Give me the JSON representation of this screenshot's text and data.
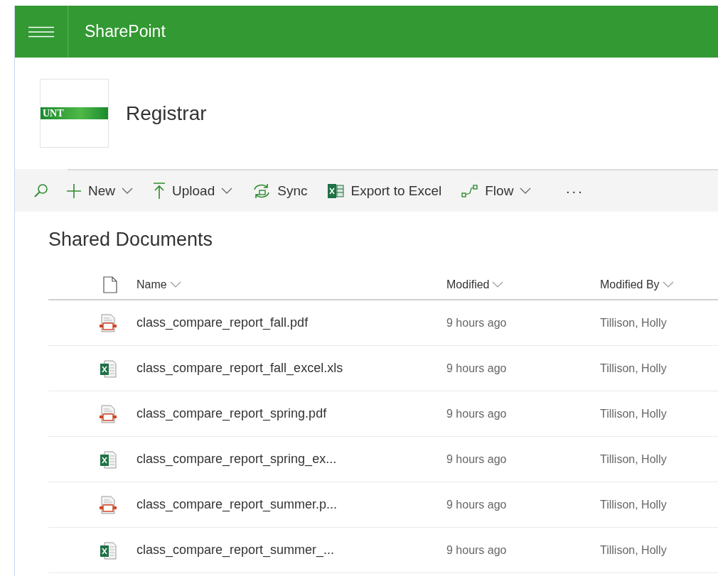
{
  "app_bar": {
    "title": "SharePoint"
  },
  "site": {
    "logo_text": "UNT",
    "title": "Registrar"
  },
  "command_bar": {
    "items": [
      {
        "kind": "new",
        "label": "New",
        "dropdown": true
      },
      {
        "kind": "upload",
        "label": "Upload",
        "dropdown": true
      },
      {
        "kind": "sync",
        "label": "Sync",
        "dropdown": false
      },
      {
        "kind": "excel",
        "label": "Export to Excel",
        "dropdown": false
      },
      {
        "kind": "flow",
        "label": "Flow",
        "dropdown": true
      }
    ],
    "more": "···"
  },
  "library": {
    "title": "Shared Documents",
    "columns": [
      "Name",
      "Modified",
      "Modified By"
    ],
    "rows": [
      {
        "kind": "pdf",
        "name": "class_compare_report_fall.pdf",
        "modified": "9 hours ago",
        "modified_by": "Tillison, Holly"
      },
      {
        "kind": "excel",
        "name": "class_compare_report_fall_excel.xls",
        "modified": "9 hours ago",
        "modified_by": "Tillison, Holly"
      },
      {
        "kind": "pdf",
        "name": "class_compare_report_spring.pdf",
        "modified": "9 hours ago",
        "modified_by": "Tillison, Holly"
      },
      {
        "kind": "excel",
        "name": "class_compare_report_spring_ex...",
        "modified": "9 hours ago",
        "modified_by": "Tillison, Holly"
      },
      {
        "kind": "pdf",
        "name": "class_compare_report_summer.p...",
        "modified": "9 hours ago",
        "modified_by": "Tillison, Holly"
      },
      {
        "kind": "excel",
        "name": "class_compare_report_summer_...",
        "modified": "9 hours ago",
        "modified_by": "Tillison, Holly"
      }
    ]
  }
}
